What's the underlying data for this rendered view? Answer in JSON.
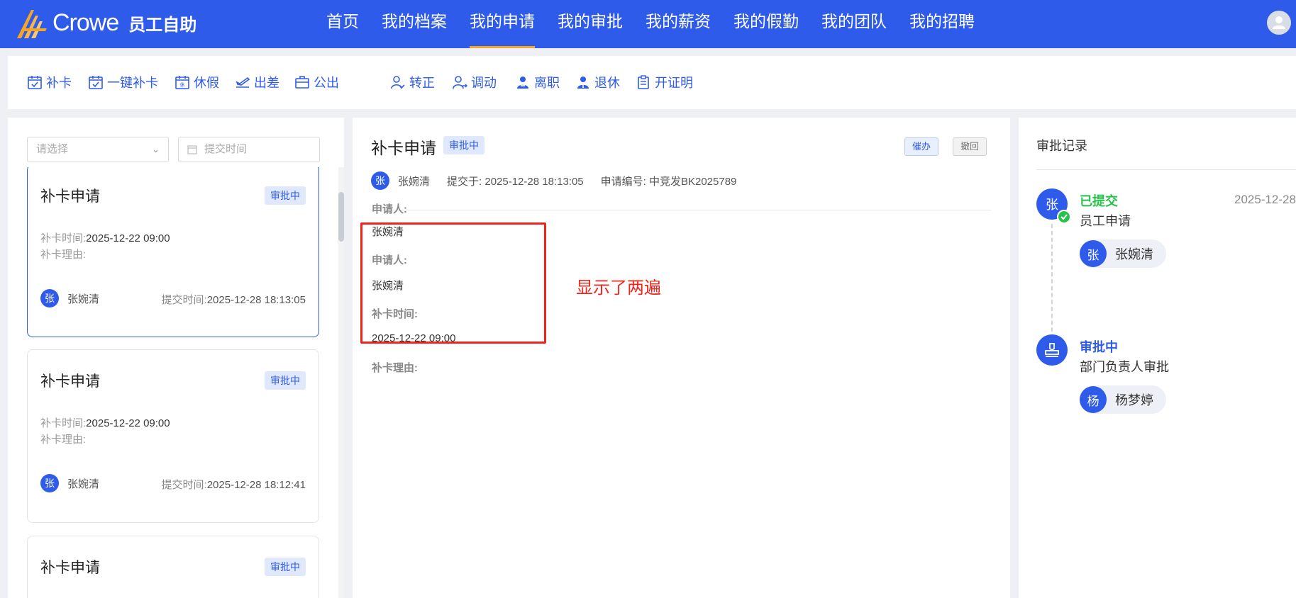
{
  "header": {
    "brand": "Crowe",
    "subtitle": "员工自助",
    "nav": [
      "首页",
      "我的档案",
      "我的申请",
      "我的审批",
      "我的薪资",
      "我的假勤",
      "我的团队",
      "我的招聘"
    ],
    "active_nav": "我的申请",
    "accent_color": "#2f5bea"
  },
  "actions": {
    "group1": [
      "补卡",
      "一键补卡",
      "休假",
      "出差",
      "公出"
    ],
    "group2": [
      "转正",
      "调动",
      "离职",
      "退休",
      "开证明"
    ]
  },
  "filters": {
    "select_placeholder": "请选择",
    "date_placeholder": "提交时间"
  },
  "list": [
    {
      "title": "补卡申请",
      "status": "审批中",
      "time_label": "补卡时间:",
      "time_value": "2025-12-22 09:00",
      "reason_label": "补卡理由:",
      "avatar": "张",
      "name": "张婉清",
      "submit_label": "提交时间:",
      "submit_value": "2025-12-28 18:13:05"
    },
    {
      "title": "补卡申请",
      "status": "审批中",
      "time_label": "补卡时间:",
      "time_value": "2025-12-22 09:00",
      "reason_label": "补卡理由:",
      "avatar": "张",
      "name": "张婉清",
      "submit_label": "提交时间:",
      "submit_value": "2025-12-28 18:12:41"
    },
    {
      "title": "补卡申请",
      "status": "审批中"
    }
  ],
  "detail": {
    "title": "补卡申请",
    "status": "审批中",
    "urge_label": "催办",
    "withdraw_label": "撤回",
    "avatar": "张",
    "applicant": "张婉清",
    "submitted": "提交于: 2025-12-28 18:13:05",
    "number": "申请编号: 中竞发BK2025789",
    "fields": {
      "applicant_label_1": "申请人:",
      "applicant_value_1": "张婉清",
      "applicant_label_2": "申请人:",
      "applicant_value_2": "张婉清",
      "time_label": "补卡时间:",
      "time_value": "2025-12-22 09:00",
      "reason_label": "补卡理由:"
    },
    "annotation": "显示了两遍"
  },
  "approval": {
    "title": "审批记录",
    "steps": [
      {
        "node": "张",
        "status": "已提交",
        "status_color": "#27c24c",
        "desc": "员工申请",
        "date": "2025-12-28",
        "person_avatar": "张",
        "person": "张婉清"
      },
      {
        "node_icon": "stamp-icon",
        "status": "审批中",
        "status_color": "#2f5bea",
        "desc": "部门负责人审批",
        "person_avatar": "杨",
        "person": "杨梦婷"
      }
    ]
  }
}
